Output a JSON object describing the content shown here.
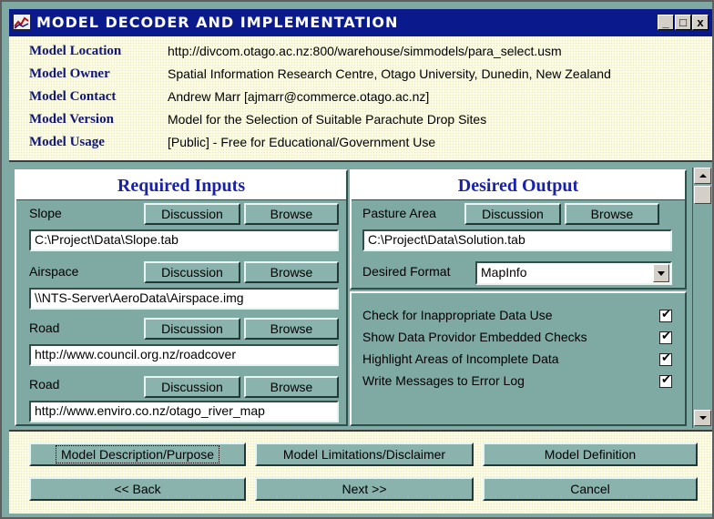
{
  "window": {
    "title": "MODEL DECODER AND IMPLEMENTATION",
    "minimize": "_",
    "maximize": "□",
    "close": "x"
  },
  "info": [
    {
      "label": "Model Location",
      "value": "http://divcom.otago.ac.nz:800/warehouse/simmodels/para_select.usm"
    },
    {
      "label": "Model Owner",
      "value": "Spatial Information Research Centre, Otago University, Dunedin, New Zealand"
    },
    {
      "label": "Model Contact",
      "value": "Andrew Marr [ajmarr@commerce.otago.ac.nz]"
    },
    {
      "label": "Model Version",
      "value": "Model for the Selection of Suitable Parachute Drop Sites"
    },
    {
      "label": "Model Usage",
      "value": "[Public] - Free for Educational/Government Use"
    }
  ],
  "inputs": {
    "header": "Required Inputs",
    "discussion_label": "Discussion",
    "browse_label": "Browse",
    "items": [
      {
        "label": "Slope",
        "value": "C:\\Project\\Data\\Slope.tab"
      },
      {
        "label": "Airspace",
        "value": "\\\\NTS-Server\\AeroData\\Airspace.img"
      },
      {
        "label": "Road",
        "value": "http://www.council.org.nz/roadcover"
      },
      {
        "label": "Road",
        "value": "http://www.enviro.co.nz/otago_river_map"
      }
    ]
  },
  "output": {
    "header": "Desired Output",
    "label": "Pasture Area",
    "discussion_label": "Discussion",
    "browse_label": "Browse",
    "value": "C:\\Project\\Data\\Solution.tab",
    "format_label": "Desired Format",
    "format_value": "MapInfo",
    "checks": [
      {
        "label": "Check for Inappropriate Data Use",
        "checked": true
      },
      {
        "label": "Show Data Providor Embedded Checks",
        "checked": true
      },
      {
        "label": "Highlight Areas of Incomplete Data",
        "checked": true
      },
      {
        "label": "Write Messages to Error Log",
        "checked": true
      }
    ]
  },
  "footer": {
    "model_description": "Model Description/Purpose",
    "model_limitations": "Model Limitations/Disclaimer",
    "model_definition": "Model Definition",
    "back": "<< Back",
    "next": "Next >>",
    "cancel": "Cancel"
  },
  "colors": {
    "title_bar": "#0a1a8c",
    "panel_bg": "#7fa9a3",
    "info_bg": "#fbfbe4",
    "header_text": "#1a23a8",
    "label_text": "#10167a"
  }
}
